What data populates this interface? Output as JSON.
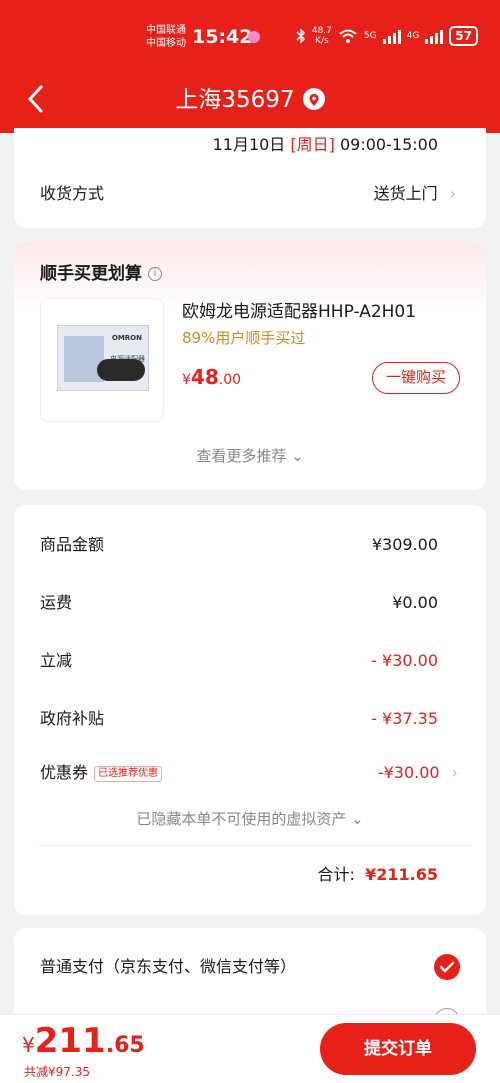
{
  "status_bar": {
    "carrier1": "中国联通",
    "carrier2": "中国移动",
    "time": "15:42",
    "net_speed_value": "48.7",
    "net_speed_unit": "K/s",
    "signal1_label": "5G",
    "signal2_label": "4G",
    "battery": "57"
  },
  "header": {
    "title": "上海35697",
    "accent_color": "#e8201a"
  },
  "delivery": {
    "date": "11月10日",
    "weekday": "[周日]",
    "time_range": "09:00-15:00",
    "method_label": "收货方式",
    "method_value": "送货上门"
  },
  "recommend": {
    "title": "顺手买更划算",
    "info_icon": "i",
    "product": {
      "image_logo": "OMRON",
      "image_text": "电源适配器",
      "name": "欧姆龙电源适配器HHP-A2H01",
      "subtitle": "89%用户顺手买过",
      "price_symbol": "¥",
      "price_int": "48",
      "price_dec": ".00",
      "buy_label": "一键购买"
    },
    "more_label": "查看更多推荐"
  },
  "summary": {
    "rows": [
      {
        "label": "商品金额",
        "value": "¥309.00"
      },
      {
        "label": "运费",
        "value": "¥0.00"
      },
      {
        "label": "立减",
        "value": "- ¥30.00"
      },
      {
        "label": "政府补贴",
        "value": "- ¥37.35"
      },
      {
        "label": "优惠券",
        "tag": "已选推荐优惠",
        "value": "-¥30.00"
      }
    ],
    "hidden_note": "已隐藏本单不可使用的虚拟资产",
    "total_label": "合计:",
    "total_value": "¥211.65"
  },
  "payment": {
    "option1": "普通支付（京东支付、微信支付等）"
  },
  "footer": {
    "price_symbol": "¥",
    "price_int": "211",
    "price_dec": ".65",
    "saved": "共减¥97.35",
    "submit_label": "提交订单"
  }
}
